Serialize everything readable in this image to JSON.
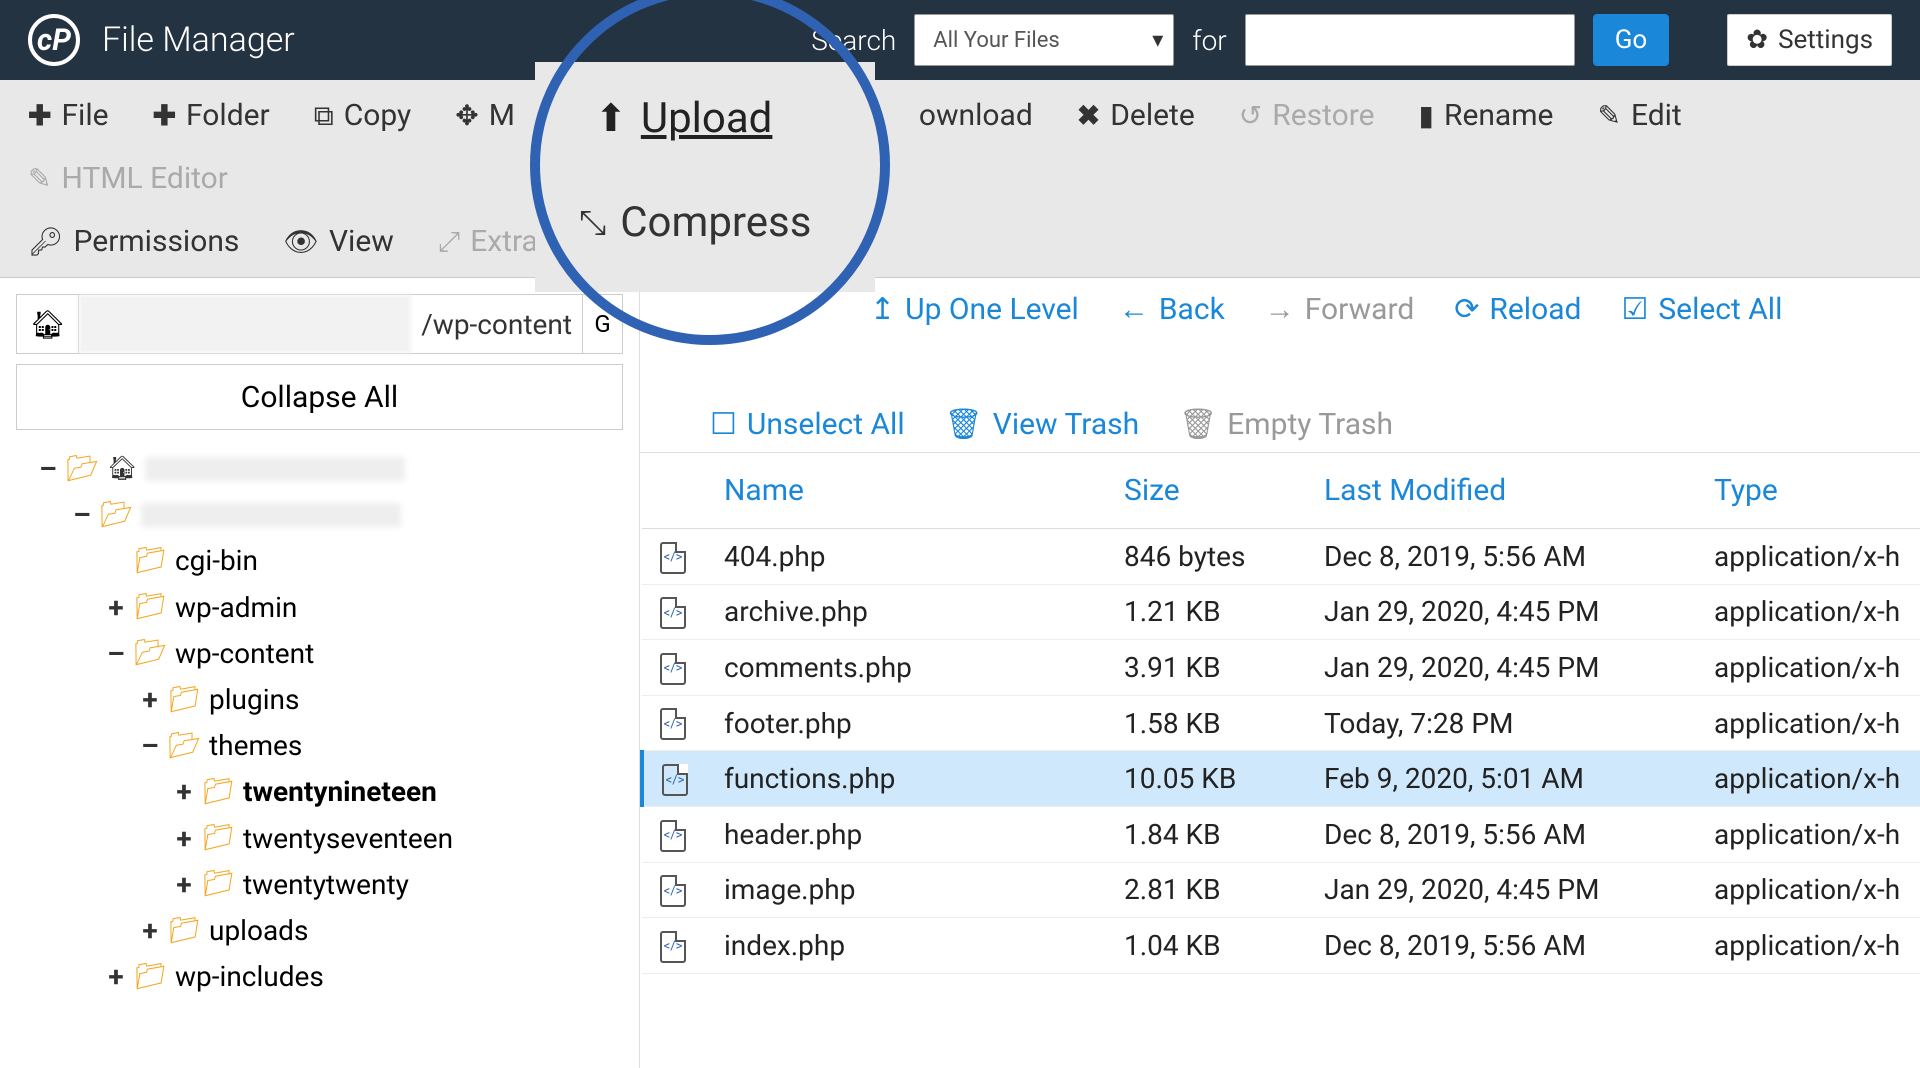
{
  "header": {
    "app_title": "File Manager",
    "search_label": "Search",
    "search_scope": "All Your Files",
    "for_label": "for",
    "search_value": "",
    "go_label": "Go",
    "settings_label": "Settings"
  },
  "toolbar": {
    "file": "File",
    "folder": "Folder",
    "copy": "Copy",
    "move_partial": "M",
    "upload": "Upload",
    "download_partial": "ownload",
    "delete": "Delete",
    "restore": "Restore",
    "rename": "Rename",
    "edit": "Edit",
    "html_editor": "HTML Editor",
    "permissions": "Permissions",
    "view": "View",
    "extract_partial": "Extra",
    "compress": "Compress"
  },
  "magnified": {
    "upload": "Upload",
    "compress": "Compress"
  },
  "left": {
    "path_suffix": "/wp-content",
    "go_indicator": "G",
    "collapse_all": "Collapse All",
    "tree": {
      "cgi_bin": "cgi-bin",
      "wp_admin": "wp-admin",
      "wp_content": "wp-content",
      "plugins": "plugins",
      "themes": "themes",
      "twentynineteen": "twentynineteen",
      "twentyseventeen": "twentyseventeen",
      "twentytwenty": "twentytwenty",
      "uploads": "uploads",
      "wp_includes": "wp-includes"
    }
  },
  "right": {
    "actions": {
      "up_one": "Up One Level",
      "back": "Back",
      "forward": "Forward",
      "reload": "Reload",
      "select_all": "Select All",
      "unselect_all": "Unselect All",
      "view_trash": "View Trash",
      "empty_trash": "Empty Trash"
    },
    "columns": {
      "name": "Name",
      "size": "Size",
      "modified": "Last Modified",
      "type": "Type"
    },
    "files": [
      {
        "name": "404.php",
        "size": "846 bytes",
        "modified": "Dec 8, 2019, 5:56 AM",
        "type": "application/x-h",
        "selected": false
      },
      {
        "name": "archive.php",
        "size": "1.21 KB",
        "modified": "Jan 29, 2020, 4:45 PM",
        "type": "application/x-h",
        "selected": false
      },
      {
        "name": "comments.php",
        "size": "3.91 KB",
        "modified": "Jan 29, 2020, 4:45 PM",
        "type": "application/x-h",
        "selected": false
      },
      {
        "name": "footer.php",
        "size": "1.58 KB",
        "modified": "Today, 7:28 PM",
        "type": "application/x-h",
        "selected": false
      },
      {
        "name": "functions.php",
        "size": "10.05 KB",
        "modified": "Feb 9, 2020, 5:01 AM",
        "type": "application/x-h",
        "selected": true
      },
      {
        "name": "header.php",
        "size": "1.84 KB",
        "modified": "Dec 8, 2019, 5:56 AM",
        "type": "application/x-h",
        "selected": false
      },
      {
        "name": "image.php",
        "size": "2.81 KB",
        "modified": "Jan 29, 2020, 4:45 PM",
        "type": "application/x-h",
        "selected": false
      },
      {
        "name": "index.php",
        "size": "1.04 KB",
        "modified": "Dec 8, 2019, 5:56 AM",
        "type": "application/x-h",
        "selected": false
      }
    ]
  }
}
